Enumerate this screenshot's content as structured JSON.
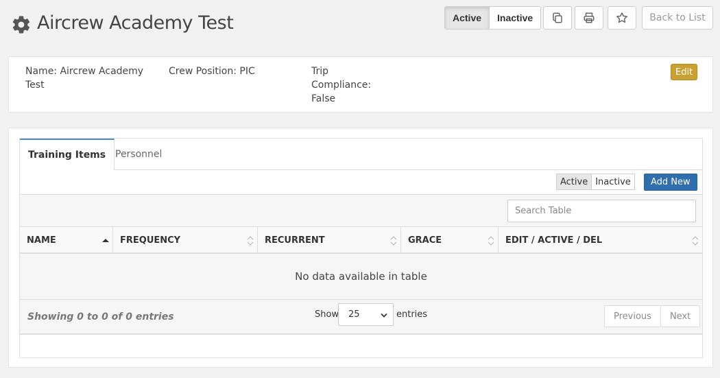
{
  "header": {
    "title": "Aircrew Academy Test",
    "title_icon": "gear-icon",
    "status_toggle": {
      "active_label": "Active",
      "inactive_label": "Inactive",
      "selected": "Active"
    },
    "copy_icon": "copy-icon",
    "print_icon": "print-icon",
    "favorite_icon": "star-icon",
    "back_label": "Back to List"
  },
  "details": {
    "name": "Name: Aircrew Academy Test",
    "crew_position": "Crew Position: PIC",
    "trip_compliance": "Trip Compliance: False",
    "edit_label": "Edit",
    "edit_color": "#c9a032"
  },
  "tabs": [
    {
      "label": "Training Items",
      "active": true
    },
    {
      "label": "Personnel",
      "active": false
    }
  ],
  "table": {
    "filter_toggle": {
      "active_label": "Active",
      "inactive_label": "Inactive",
      "selected": "Active"
    },
    "add_label": "Add New",
    "add_color": "#2f6fad",
    "search_placeholder": "Search Table",
    "columns": [
      {
        "label": "NAME",
        "sort": "asc"
      },
      {
        "label": "FREQUENCY",
        "sort": "none"
      },
      {
        "label": "RECURRENT",
        "sort": "none"
      },
      {
        "label": "GRACE",
        "sort": "none"
      },
      {
        "label": "EDIT / ACTIVE / DEL",
        "sort": "none"
      }
    ],
    "empty_message": "No data available in table",
    "info": "Showing 0 to 0 of 0 entries",
    "show_label": "Show",
    "page_length": "25",
    "entries_label": "entries",
    "prev_label": "Previous",
    "next_label": "Next"
  }
}
